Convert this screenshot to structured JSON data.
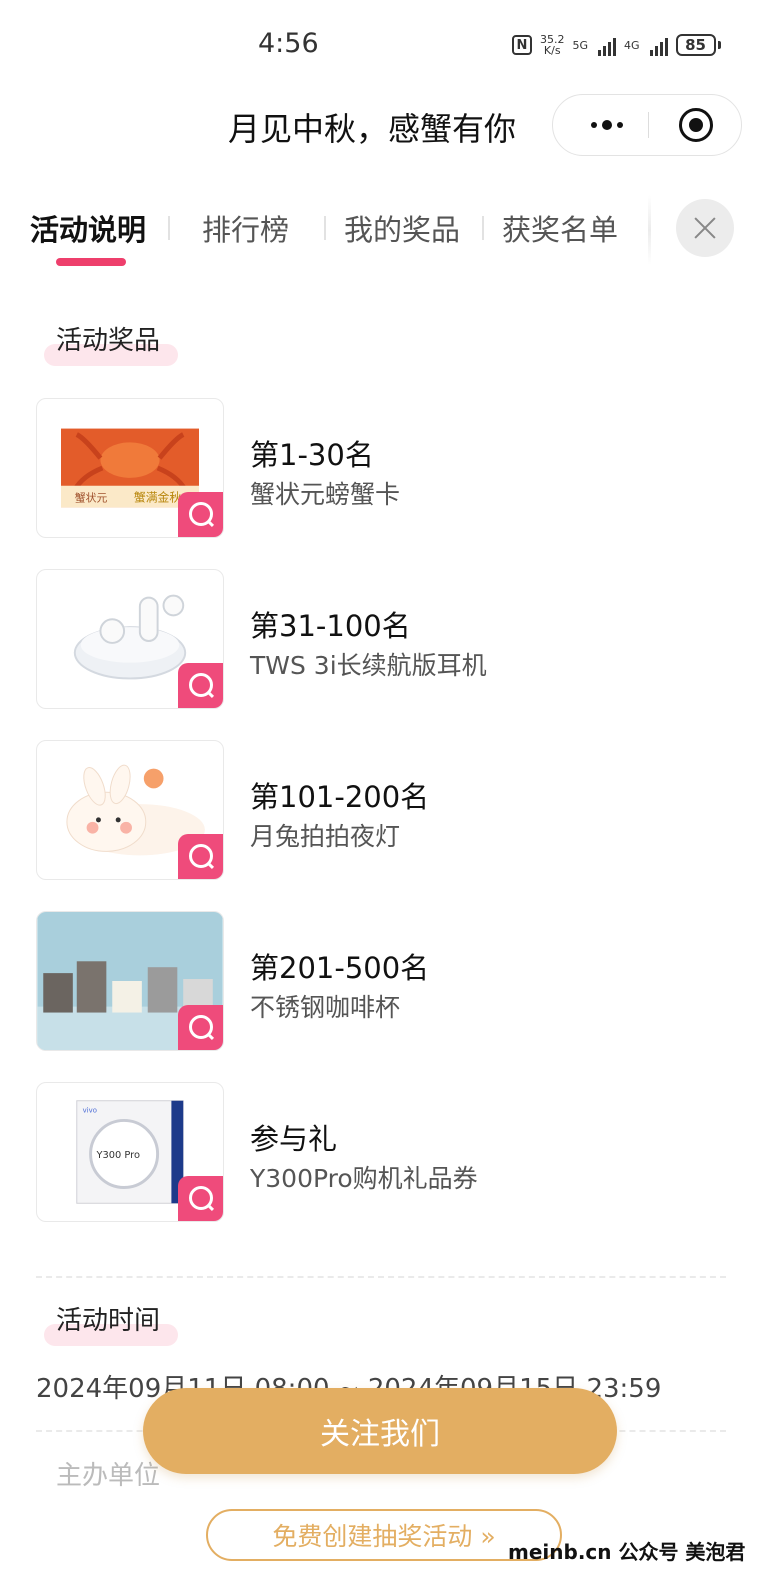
{
  "status": {
    "time": "4:56",
    "nfc": "N",
    "speed_top": "35.2",
    "speed_bottom": "K/s",
    "net1": "5G",
    "net2": "4G",
    "battery": "85"
  },
  "title": "月见中秋，感蟹有你",
  "tabs": [
    {
      "label": "活动说明"
    },
    {
      "label": "排行榜"
    },
    {
      "label": "我的奖品"
    },
    {
      "label": "获奖名单"
    }
  ],
  "prize_section": {
    "title": "活动奖品"
  },
  "prizes": [
    {
      "rank": "第1-30名",
      "name": "蟹状元螃蟹卡",
      "image_text_1": "蟹状元",
      "image_text_2": "蟹满金秋"
    },
    {
      "rank": "第31-100名",
      "name": "TWS 3i长续航版耳机"
    },
    {
      "rank": "第101-200名",
      "name": "月兔拍拍夜灯"
    },
    {
      "rank": "第201-500名",
      "name": "不锈钢咖啡杯"
    },
    {
      "rank": "参与礼",
      "name": "Y300Pro购机礼品券",
      "image_text_1": "Y300 Pro",
      "image_text_2": "vivo"
    }
  ],
  "time_section": {
    "title": "活动时间",
    "value": "2024年09月11日 08:00 ~ 2024年09月15日 23:59"
  },
  "organizer": {
    "label": "主办单位"
  },
  "buttons": {
    "follow": "关注我们",
    "create": "免费创建抽奖活动 »"
  },
  "watermark": "meinb.cn  公众号 美泡君",
  "colors": {
    "accent": "#ee3f6c",
    "gold": "#e3ae62",
    "section_bg": "#fde6ec"
  }
}
